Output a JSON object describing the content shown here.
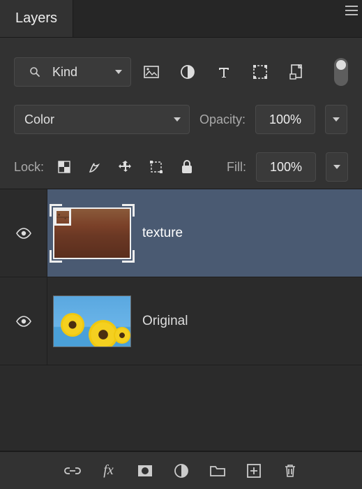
{
  "tab": {
    "title": "Layers"
  },
  "filter": {
    "label": "Kind"
  },
  "blend": {
    "mode": "Color"
  },
  "opacity": {
    "label": "Opacity:",
    "value": "100%"
  },
  "lock": {
    "label": "Lock:"
  },
  "fill": {
    "label": "Fill:",
    "value": "100%"
  },
  "layers": [
    {
      "name": "texture"
    },
    {
      "name": "Original"
    }
  ]
}
